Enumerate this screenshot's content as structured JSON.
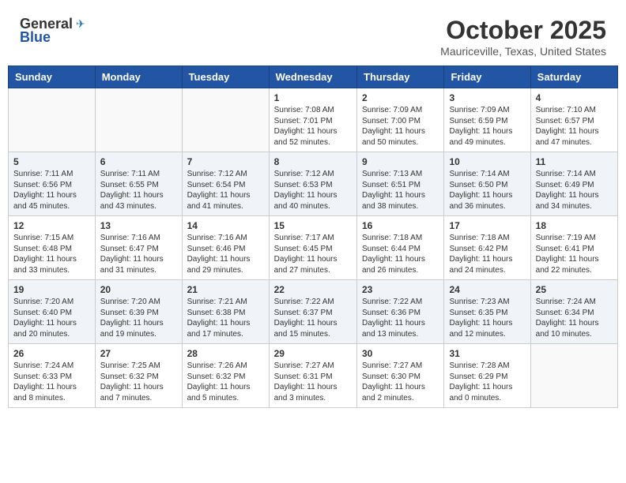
{
  "header": {
    "logo_general": "General",
    "logo_blue": "Blue",
    "month_title": "October 2025",
    "location": "Mauriceville, Texas, United States"
  },
  "days_of_week": [
    "Sunday",
    "Monday",
    "Tuesday",
    "Wednesday",
    "Thursday",
    "Friday",
    "Saturday"
  ],
  "weeks": [
    [
      {
        "day": "",
        "info": ""
      },
      {
        "day": "",
        "info": ""
      },
      {
        "day": "",
        "info": ""
      },
      {
        "day": "1",
        "info": "Sunrise: 7:08 AM\nSunset: 7:01 PM\nDaylight: 11 hours\nand 52 minutes."
      },
      {
        "day": "2",
        "info": "Sunrise: 7:09 AM\nSunset: 7:00 PM\nDaylight: 11 hours\nand 50 minutes."
      },
      {
        "day": "3",
        "info": "Sunrise: 7:09 AM\nSunset: 6:59 PM\nDaylight: 11 hours\nand 49 minutes."
      },
      {
        "day": "4",
        "info": "Sunrise: 7:10 AM\nSunset: 6:57 PM\nDaylight: 11 hours\nand 47 minutes."
      }
    ],
    [
      {
        "day": "5",
        "info": "Sunrise: 7:11 AM\nSunset: 6:56 PM\nDaylight: 11 hours\nand 45 minutes."
      },
      {
        "day": "6",
        "info": "Sunrise: 7:11 AM\nSunset: 6:55 PM\nDaylight: 11 hours\nand 43 minutes."
      },
      {
        "day": "7",
        "info": "Sunrise: 7:12 AM\nSunset: 6:54 PM\nDaylight: 11 hours\nand 41 minutes."
      },
      {
        "day": "8",
        "info": "Sunrise: 7:12 AM\nSunset: 6:53 PM\nDaylight: 11 hours\nand 40 minutes."
      },
      {
        "day": "9",
        "info": "Sunrise: 7:13 AM\nSunset: 6:51 PM\nDaylight: 11 hours\nand 38 minutes."
      },
      {
        "day": "10",
        "info": "Sunrise: 7:14 AM\nSunset: 6:50 PM\nDaylight: 11 hours\nand 36 minutes."
      },
      {
        "day": "11",
        "info": "Sunrise: 7:14 AM\nSunset: 6:49 PM\nDaylight: 11 hours\nand 34 minutes."
      }
    ],
    [
      {
        "day": "12",
        "info": "Sunrise: 7:15 AM\nSunset: 6:48 PM\nDaylight: 11 hours\nand 33 minutes."
      },
      {
        "day": "13",
        "info": "Sunrise: 7:16 AM\nSunset: 6:47 PM\nDaylight: 11 hours\nand 31 minutes."
      },
      {
        "day": "14",
        "info": "Sunrise: 7:16 AM\nSunset: 6:46 PM\nDaylight: 11 hours\nand 29 minutes."
      },
      {
        "day": "15",
        "info": "Sunrise: 7:17 AM\nSunset: 6:45 PM\nDaylight: 11 hours\nand 27 minutes."
      },
      {
        "day": "16",
        "info": "Sunrise: 7:18 AM\nSunset: 6:44 PM\nDaylight: 11 hours\nand 26 minutes."
      },
      {
        "day": "17",
        "info": "Sunrise: 7:18 AM\nSunset: 6:42 PM\nDaylight: 11 hours\nand 24 minutes."
      },
      {
        "day": "18",
        "info": "Sunrise: 7:19 AM\nSunset: 6:41 PM\nDaylight: 11 hours\nand 22 minutes."
      }
    ],
    [
      {
        "day": "19",
        "info": "Sunrise: 7:20 AM\nSunset: 6:40 PM\nDaylight: 11 hours\nand 20 minutes."
      },
      {
        "day": "20",
        "info": "Sunrise: 7:20 AM\nSunset: 6:39 PM\nDaylight: 11 hours\nand 19 minutes."
      },
      {
        "day": "21",
        "info": "Sunrise: 7:21 AM\nSunset: 6:38 PM\nDaylight: 11 hours\nand 17 minutes."
      },
      {
        "day": "22",
        "info": "Sunrise: 7:22 AM\nSunset: 6:37 PM\nDaylight: 11 hours\nand 15 minutes."
      },
      {
        "day": "23",
        "info": "Sunrise: 7:22 AM\nSunset: 6:36 PM\nDaylight: 11 hours\nand 13 minutes."
      },
      {
        "day": "24",
        "info": "Sunrise: 7:23 AM\nSunset: 6:35 PM\nDaylight: 11 hours\nand 12 minutes."
      },
      {
        "day": "25",
        "info": "Sunrise: 7:24 AM\nSunset: 6:34 PM\nDaylight: 11 hours\nand 10 minutes."
      }
    ],
    [
      {
        "day": "26",
        "info": "Sunrise: 7:24 AM\nSunset: 6:33 PM\nDaylight: 11 hours\nand 8 minutes."
      },
      {
        "day": "27",
        "info": "Sunrise: 7:25 AM\nSunset: 6:32 PM\nDaylight: 11 hours\nand 7 minutes."
      },
      {
        "day": "28",
        "info": "Sunrise: 7:26 AM\nSunset: 6:32 PM\nDaylight: 11 hours\nand 5 minutes."
      },
      {
        "day": "29",
        "info": "Sunrise: 7:27 AM\nSunset: 6:31 PM\nDaylight: 11 hours\nand 3 minutes."
      },
      {
        "day": "30",
        "info": "Sunrise: 7:27 AM\nSunset: 6:30 PM\nDaylight: 11 hours\nand 2 minutes."
      },
      {
        "day": "31",
        "info": "Sunrise: 7:28 AM\nSunset: 6:29 PM\nDaylight: 11 hours\nand 0 minutes."
      },
      {
        "day": "",
        "info": ""
      }
    ]
  ]
}
